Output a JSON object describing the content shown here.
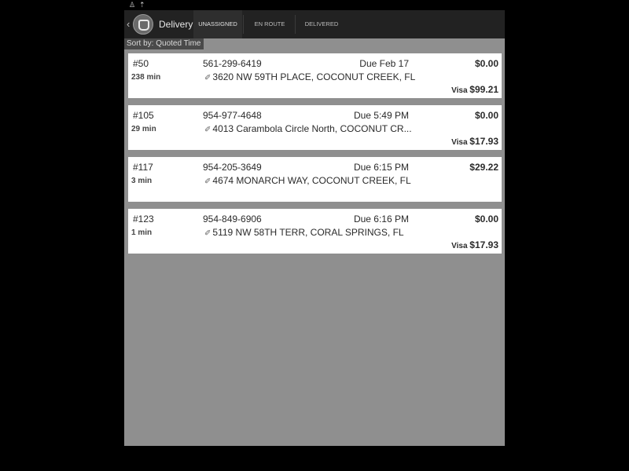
{
  "status_icons": [
    "person-icon",
    "upload-icon"
  ],
  "toolbar": {
    "back_icon": "chevron-left-icon",
    "app_icon": "bell-icon",
    "title": "Delivery"
  },
  "tabs": [
    {
      "label": "UNASSIGNED",
      "active": true
    },
    {
      "label": "EN ROUTE",
      "active": false
    },
    {
      "label": "DELIVERED",
      "active": false
    }
  ],
  "sort_label": "Sort by: Quoted Time",
  "orders": [
    {
      "number": "#50",
      "minutes": "238 min",
      "phone": "561-299-6419",
      "due": "Due Feb 17",
      "address": "3620 NW 59TH PLACE, COCONUT CREEK, FL",
      "amount": "$0.00",
      "payment_method": "Visa",
      "payment_amount": "$99.21"
    },
    {
      "number": "#105",
      "minutes": "29 min",
      "phone": "954-977-4648",
      "due": "Due 5:49 PM",
      "address": "4013 Carambola Circle North, COCONUT CR...",
      "amount": "$0.00",
      "payment_method": "Visa",
      "payment_amount": "$17.93"
    },
    {
      "number": "#117",
      "minutes": "3 min",
      "phone": "954-205-3649",
      "due": "Due 6:15 PM",
      "address": "4674 MONARCH WAY, COCONUT CREEK, FL",
      "amount": "$29.22",
      "payment_method": "",
      "payment_amount": ""
    },
    {
      "number": "#123",
      "minutes": "1 min",
      "phone": "954-849-6906",
      "due": "Due 6:16 PM",
      "address": "5119 NW 58TH TERR, CORAL SPRINGS, FL",
      "amount": "$0.00",
      "payment_method": "Visa",
      "payment_amount": "$17.93"
    }
  ]
}
